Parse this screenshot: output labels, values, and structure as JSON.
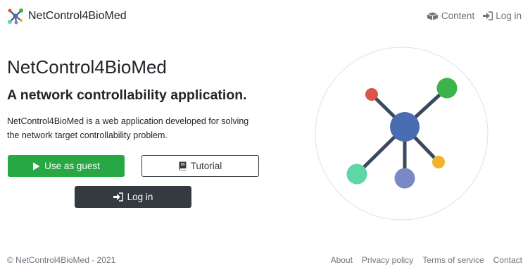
{
  "navbar": {
    "brand": "NetControl4BioMed",
    "links": [
      {
        "label": "Content",
        "icon": "box-open-icon"
      },
      {
        "label": "Log in",
        "icon": "sign-in-icon"
      }
    ]
  },
  "hero": {
    "title": "NetControl4BioMed",
    "subtitle": "A network controllability application.",
    "description": "NetControl4BioMed is a web application developed for solving the network target controllability problem.",
    "buttons": {
      "guest": "Use as guest",
      "tutorial": "Tutorial",
      "login": "Log in"
    }
  },
  "footer": {
    "copyright": "© NetControl4BioMed - 2021",
    "links": [
      "About",
      "Privacy policy",
      "Terms of service",
      "Contact"
    ]
  },
  "colors": {
    "primary_success": "#28a745",
    "dark": "#343a40",
    "muted": "#6c757d",
    "node_center": "#4a6cb0",
    "node_green": "#3cb44b",
    "node_red": "#d9534f",
    "node_teal": "#5fd6a4",
    "node_purple": "#7a88c6",
    "node_yellow": "#f0b429"
  }
}
